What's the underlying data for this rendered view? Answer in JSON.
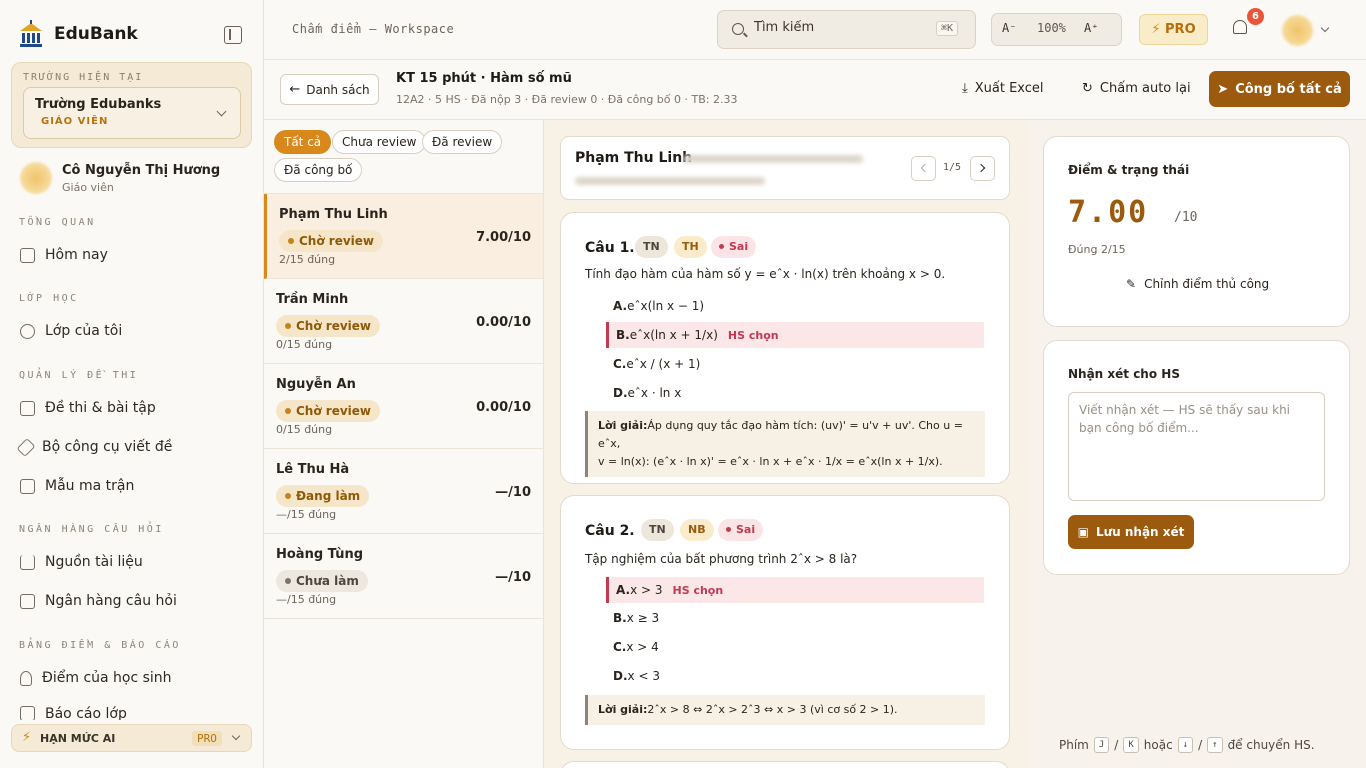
{
  "brand": {
    "name": "EduBank"
  },
  "school": {
    "caption": "TRƯỜNG HIỆN TẠI",
    "name": "Trường Edubanks",
    "role": "GIÁO VIÊN"
  },
  "user": {
    "name": "Cô Nguyễn Thị Hương",
    "role": "Giáo viên"
  },
  "nav": [
    {
      "section": "TỔNG QUAN",
      "items": [
        "Hôm nay"
      ]
    },
    {
      "section": "LỚP HỌC",
      "items": [
        "Lớp của tôi"
      ]
    },
    {
      "section": "QUẢN LÝ ĐỀ THI",
      "items": [
        "Đề thi & bài tập",
        "Bộ công cụ viết đề",
        "Mẫu ma trận"
      ]
    },
    {
      "section": "NGÂN HÀNG CÂU HỎI",
      "items": [
        "Nguồn tài liệu",
        "Ngân hàng câu hỏi"
      ]
    },
    {
      "section": "BẢNG ĐIỂM & BÁO CÁO",
      "items": [
        "Điểm của học sinh",
        "Báo cáo lớp"
      ]
    }
  ],
  "quota": {
    "label": "HẠN MỨC AI",
    "badge": "PRO"
  },
  "topbar": {
    "title": "Chấm điểm — Workspace",
    "search_placeholder": "Tìm kiếm",
    "search_shortcut": "⌘K",
    "zoom_minus": "A⁻",
    "zoom_value": "100%",
    "zoom_plus": "A⁺",
    "pro": "PRO",
    "notifications": "6"
  },
  "subheader": {
    "back_label": "Danh sách",
    "exam_title": "KT 15 phút · Hàm số mũ",
    "exam_meta": "12A2 · 5 HS · Đã nộp 3 · Đã review 0 · Đã công bố 0 · TB: 2.33",
    "export_label": "Xuất Excel",
    "regrade_label": "Chấm auto lại",
    "publish_label": "Công bố tất cả"
  },
  "filters": [
    "Tất cả",
    "Chưa review",
    "Đã review",
    "Đã công bố"
  ],
  "students": [
    {
      "name": "Phạm Thu Linh",
      "status": "Chờ review",
      "score": "7.00/10",
      "correct": "2/15 đúng"
    },
    {
      "name": "Trần Minh",
      "status": "Chờ review",
      "score": "0.00/10",
      "correct": "0/15 đúng"
    },
    {
      "name": "Nguyễn An",
      "status": "Chờ review",
      "score": "0.00/10",
      "correct": "0/15 đúng"
    },
    {
      "name": "Lê Thu Hà",
      "status": "Đang làm",
      "score": "—/10",
      "correct": "—/15 đúng"
    },
    {
      "name": "Hoàng Tùng",
      "status": "Chưa làm",
      "score": "—/10",
      "correct": "—/15 đúng"
    }
  ],
  "detail": {
    "student_name": "Phạm Thu Linh",
    "pager": "1/5",
    "chosen_label": "HS chọn",
    "questions": [
      {
        "number": "Câu 1.",
        "tags": [
          "TN",
          "TH",
          "Sai"
        ],
        "text": "Tính đạo hàm của hàm số y = eˆx · ln(x) trên khoảng x > 0.",
        "options": [
          {
            "key": "A.",
            "text": "eˆx(ln x − 1)"
          },
          {
            "key": "B.",
            "text": "eˆx(ln x + 1/x)"
          },
          {
            "key": "C.",
            "text": "eˆx / (x + 1)"
          },
          {
            "key": "D.",
            "text": "eˆx · ln x"
          }
        ],
        "solution_label": "Lời giải:",
        "solution_line1": "Áp dụng quy tắc đạo hàm tích: (uv)' = u'v + uv'. Cho u = eˆx,",
        "solution_line2": "v = ln(x): (eˆx · ln x)' = eˆx · ln x + eˆx · 1/x = eˆx(ln x + 1/x)."
      },
      {
        "number": "Câu 2.",
        "tags": [
          "TN",
          "NB",
          "Sai"
        ],
        "text": "Tập nghiệm của bất phương trình 2ˆx > 8 là?",
        "options": [
          {
            "key": "A.",
            "text": "x > 3"
          },
          {
            "key": "B.",
            "text": "x ≥ 3"
          },
          {
            "key": "C.",
            "text": "x > 4"
          },
          {
            "key": "D.",
            "text": "x < 3"
          }
        ],
        "solution_label": "Lời giải:",
        "solution_line1": "2ˆx > 8 ⇔ 2ˆx > 2ˆ3 ⇔ x > 3 (vì cơ số 2 > 1)."
      }
    ]
  },
  "score_panel": {
    "title": "Điểm & trạng thái",
    "score": "7.00",
    "max": "/10",
    "correct": "Đúng 2/15",
    "manual_label": "Chỉnh điểm thủ công"
  },
  "comment_panel": {
    "title": "Nhận xét cho HS",
    "placeholder": "Viết nhận xét — HS sẽ thấy sau khi bạn công bố điểm...",
    "save_label": "Lưu nhận xét"
  },
  "hint": {
    "prefix": "Phím",
    "k1": "J",
    "sep1": "/",
    "k2": "K",
    "mid": "hoặc",
    "k3": "↓",
    "sep2": "/",
    "k4": "↑",
    "suffix": "để chuyển HS."
  },
  "colors": {
    "accent": "#9c5a0f",
    "active_filter": "#d9891c",
    "wrong": "#c23a51",
    "notification": "#e8553a"
  }
}
